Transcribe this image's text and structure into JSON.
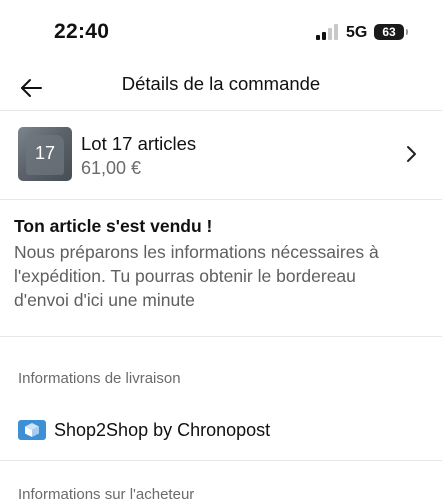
{
  "status_bar": {
    "time": "22:40",
    "network": "5G",
    "battery_percent": "63"
  },
  "header": {
    "title": "Détails de la commande",
    "back_icon": "arrow-left-icon"
  },
  "item": {
    "thumbnail_count": "17",
    "title": "Lot 17 articles",
    "price": "61,00 €",
    "chevron_icon": "chevron-right-icon"
  },
  "sold_message": {
    "title": "Ton article s'est vendu !",
    "body_lines": [
      "Nous préparons les informations nécessaires à",
      "l'expédition. Tu pourras obtenir le bordereau",
      "d'envoi d'ici une minute"
    ]
  },
  "delivery": {
    "section_label": "Informations de livraison",
    "carrier_icon": "package-icon",
    "carrier_name": "Shop2Shop by Chronopost"
  },
  "next_section": {
    "label": "Informations sur l'acheteur"
  },
  "colors": {
    "accent_blue": "#3d8fd6",
    "text_primary": "#111111",
    "text_secondary": "#6b6b6b",
    "divider": "#e6e6e6"
  }
}
